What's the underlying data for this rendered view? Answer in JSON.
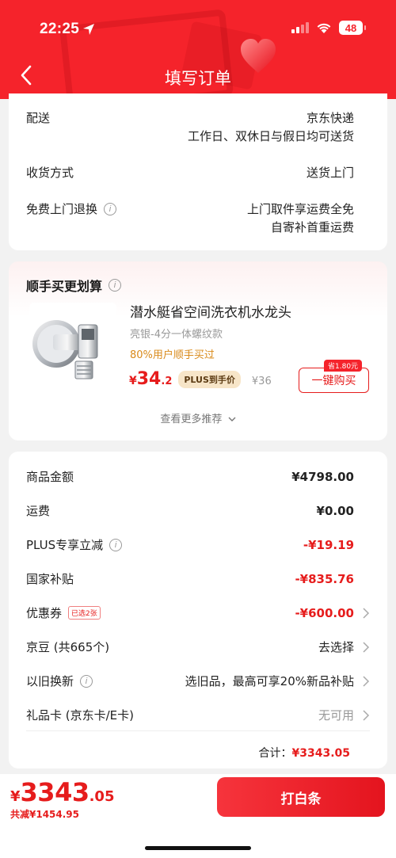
{
  "status_bar": {
    "time": "22:25",
    "battery": "48"
  },
  "nav": {
    "title": "填写订单"
  },
  "delivery": {
    "rows": [
      {
        "label": "配送",
        "value_lines": [
          "京东快递",
          "工作日、双休日与假日均可送货"
        ]
      },
      {
        "label": "收货方式",
        "value_lines": [
          "送货上门"
        ]
      },
      {
        "label": "免费上门退换",
        "value_lines": [
          "上门取件享运费全免",
          "自寄补首重运费"
        ]
      }
    ]
  },
  "recommend": {
    "title": "顺手买更划算",
    "product": {
      "name": "潜水艇省空间洗衣机水龙头",
      "spec": "亮银-4分一体螺纹款",
      "buyers": "80%用户顺手买过",
      "price_currency": "¥",
      "price_int": "34",
      "price_dec": ".2",
      "plus_tag": "PLUS到手价",
      "orig_price": "¥36",
      "save_tag": "省1.80元",
      "buy_label": "一键购买"
    },
    "more": "查看更多推荐"
  },
  "summary": {
    "rows": [
      {
        "label": "商品金额",
        "value": "¥4798.00"
      },
      {
        "label": "运费",
        "value": "¥0.00"
      },
      {
        "label": "PLUS专享立减",
        "value": "-¥19.19"
      },
      {
        "label": "国家补贴",
        "value": "-¥835.76"
      },
      {
        "label": "优惠券",
        "tag": "已选2张",
        "value": "-¥600.00"
      },
      {
        "label": "京豆 (共665个)",
        "value": "去选择"
      },
      {
        "label": "以旧换新",
        "value": "选旧品，最高可享20%新品补贴"
      },
      {
        "label": "礼品卡 (京东卡/E卡)",
        "value": "无可用"
      }
    ],
    "total_label": "合计：",
    "total_value": "¥3343.05"
  },
  "bottom": {
    "currency": "¥",
    "int": "3343",
    "dec": ".05",
    "saved": "共减¥1454.95",
    "pay_label": "打白条"
  },
  "colors": {
    "brand_red": "#f5232b",
    "price_red": "#e61c1c",
    "plus_gold": "#f7e5c8"
  }
}
